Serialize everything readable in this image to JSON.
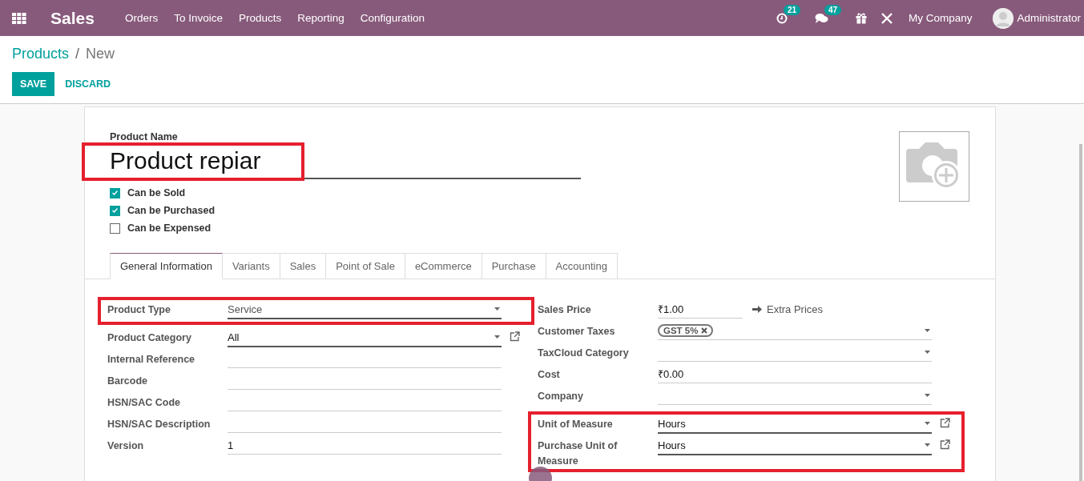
{
  "navbar": {
    "app_name": "Sales",
    "menu": [
      "Orders",
      "To Invoice",
      "Products",
      "Reporting",
      "Configuration"
    ],
    "activity_count": "21",
    "message_count": "47",
    "company": "My Company",
    "user": "Administrator"
  },
  "breadcrumb": {
    "parent": "Products",
    "separator": "/",
    "current": "New"
  },
  "buttons": {
    "save": "SAVE",
    "discard": "DISCARD"
  },
  "product_name": {
    "label": "Product Name",
    "value": "Product repiar",
    "highlighted": true
  },
  "options": [
    {
      "label": "Can be Sold",
      "checked": true
    },
    {
      "label": "Can be Purchased",
      "checked": true
    },
    {
      "label": "Can be Expensed",
      "checked": false
    }
  ],
  "tabs": [
    {
      "label": "General Information",
      "selected": true
    },
    {
      "label": "Variants",
      "selected": false
    },
    {
      "label": "Sales",
      "selected": false
    },
    {
      "label": "Point of Sale",
      "selected": false
    },
    {
      "label": "eCommerce",
      "selected": false
    },
    {
      "label": "Purchase",
      "selected": false
    },
    {
      "label": "Accounting",
      "selected": false
    }
  ],
  "left_fields": [
    {
      "label": "Product Type",
      "kind": "select",
      "value": "Service",
      "highlighted": true
    },
    {
      "label": "Product Category",
      "kind": "many2one",
      "value": "All",
      "highlighted": false
    },
    {
      "label": "Internal Reference",
      "kind": "text",
      "highlighted": false
    },
    {
      "label": "Barcode",
      "kind": "text",
      "highlighted": false
    },
    {
      "label": "HSN/SAC Code",
      "kind": "text",
      "highlighted": false
    },
    {
      "label": "HSN/SAC Description",
      "kind": "text",
      "highlighted": false
    },
    {
      "label": "Version",
      "kind": "text",
      "value": "1",
      "highlighted": false
    }
  ],
  "right_fields": [
    {
      "label": "Sales Price",
      "kind": "price",
      "value": "₹1.00",
      "button": "Extra Prices",
      "highlighted": false
    },
    {
      "label": "Customer Taxes",
      "kind": "tags",
      "tags": [
        "GST 5%"
      ],
      "highlighted": false
    },
    {
      "label": "TaxCloud Category",
      "kind": "select",
      "highlighted": false
    },
    {
      "label": "Cost",
      "kind": "text",
      "value": "₹0.00",
      "highlighted": false
    },
    {
      "label": "Company",
      "kind": "select",
      "highlighted": false
    },
    {
      "label": "Unit of Measure",
      "kind": "many2one",
      "value": "Hours",
      "highlighted": true
    },
    {
      "label": "Purchase Unit of Measure",
      "kind": "many2one",
      "value": "Hours",
      "highlighted": true
    }
  ]
}
